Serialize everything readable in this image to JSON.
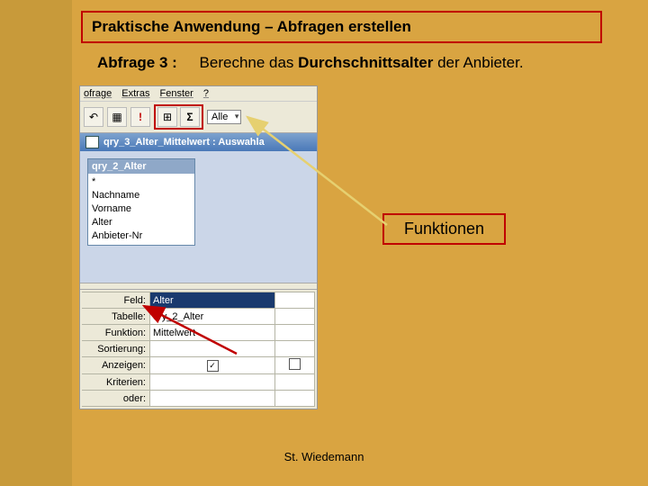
{
  "title": "Praktische Anwendung – Abfragen erstellen",
  "subtitle_label": "Abfrage 3 :",
  "subtitle_prefix": "Berechne das ",
  "subtitle_bold": "Durchschnittsalter",
  "subtitle_suffix": " der Anbieter.",
  "menubar": {
    "m1": "ofrage",
    "m2": "Extras",
    "m3": "Fenster",
    "m4": "?"
  },
  "toolbar": {
    "bang": "!",
    "sigma": "Σ",
    "alle": "Alle"
  },
  "mdi_title": "qry_3_Alter_Mittelwert : Auswahla",
  "source": {
    "name": "qry_2_Alter",
    "fields": [
      "*",
      "Nachname",
      "Vorname",
      "Alter",
      "Anbieter-Nr"
    ]
  },
  "grid": {
    "rows": {
      "feld": "Feld:",
      "tabelle": "Tabelle:",
      "funktion": "Funktion:",
      "sortierung": "Sortierung:",
      "anzeigen": "Anzeigen:",
      "kriterien": "Kriterien:",
      "oder": "oder:"
    },
    "vals": {
      "feld": "Alter",
      "tabelle": "qry_2_Alter",
      "funktion": "Mittelwert",
      "check": "✓"
    }
  },
  "callout": "Funktionen",
  "footer": "St. Wiedemann"
}
